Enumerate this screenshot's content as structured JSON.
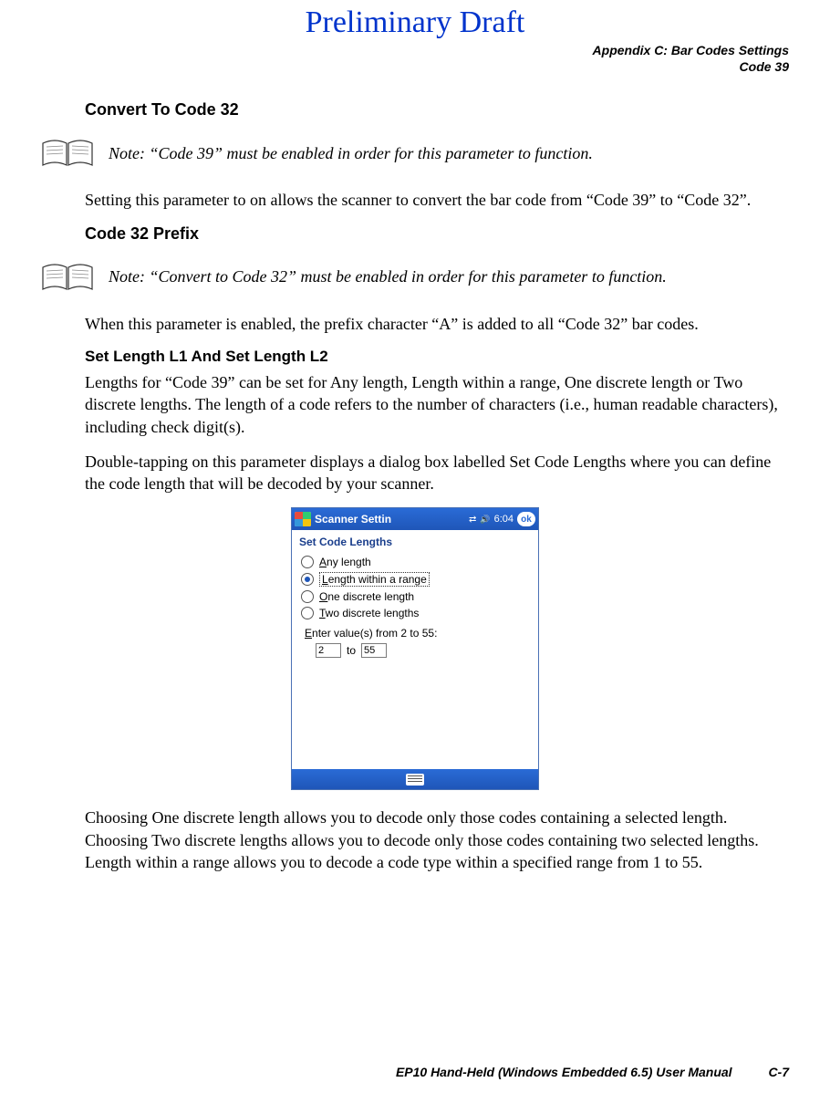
{
  "watermark": "Preliminary Draft",
  "header": {
    "line1": "Appendix C: Bar Codes Settings",
    "line2": "Code 39"
  },
  "sections": {
    "convert_title": "Convert To Code 32",
    "note1_prefix": "Note: ",
    "note1_body": "“Code 39” must be enabled in order for this parameter to function.",
    "convert_body": "Setting this parameter to on allows the scanner to convert the bar code from “Code 39” to “Code 32”.",
    "prefix_title": "Code 32 Prefix",
    "note2_prefix": "Note: ",
    "note2_body": "“Convert to Code 32” must be enabled in order for this parameter to function.",
    "prefix_body": "When this parameter is enabled, the prefix character “A” is added to all “Code 32” bar codes.",
    "length_title": "Set Length L1 And Set Length L2",
    "length_p1": "Lengths for “Code 39” can be set for Any length, Length within a range, One discrete length or Two discrete lengths. The length of a code refers to the number of characters (i.e., human readable characters), including check digit(s).",
    "length_p2": "Double-tapping on this parameter displays a dialog box labelled Set Code Lengths where you can define the code length that will be decoded by your scanner.",
    "length_p3": "Choosing One discrete length allows you to decode only those codes containing a selected length. Choosing Two discrete lengths allows you to decode only those codes containing two selected lengths. Length within a range allows you to decode a code type within a specified range from 1 to 55."
  },
  "dialog": {
    "window_title": "Scanner Settin",
    "time": "6:04",
    "ok": "ok",
    "subtitle": "Set Code Lengths",
    "options": {
      "any": "Any length",
      "range": "Length within a range",
      "one": "One discrete length",
      "two": "Two discrete lengths"
    },
    "underline": {
      "any": "A",
      "range": "L",
      "one": "O",
      "two": "T",
      "enter": "E"
    },
    "enter_label_rest": "nter value(s) from 2 to 55:",
    "from_value": "2",
    "to_label": "to",
    "to_value": "55"
  },
  "footer": {
    "manual": "EP10 Hand-Held (Windows Embedded 6.5) User Manual",
    "page": "C-7"
  }
}
